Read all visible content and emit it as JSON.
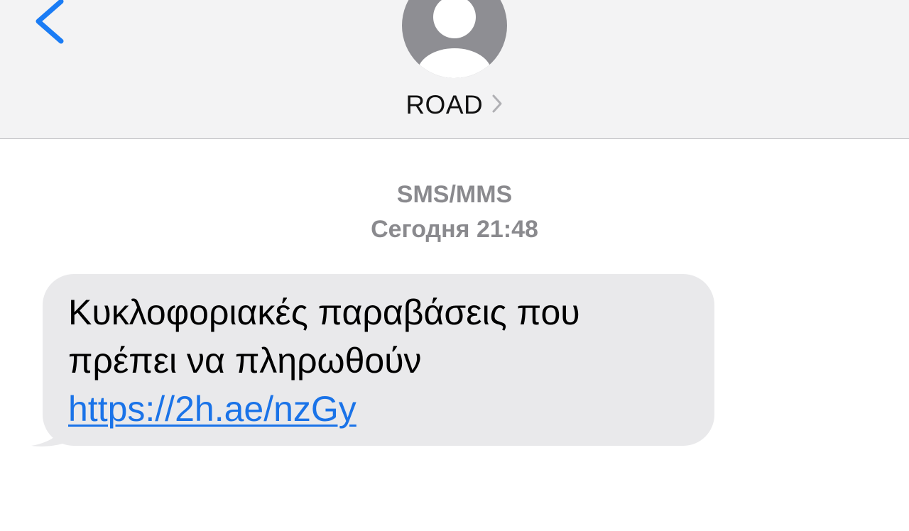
{
  "header": {
    "back_icon": "chevron-left-icon",
    "avatar_icon": "person-silhouette-icon",
    "contact_name": "ROAD",
    "contact_chevron_icon": "chevron-right-icon",
    "background_color": "#f3f3f4",
    "accent_color": "#1a7cf5"
  },
  "conversation": {
    "service_label": "SMS/MMS",
    "timestamp": "Сегодня 21:48",
    "messages": [
      {
        "direction": "incoming",
        "text": "Κυκλοφοριακές παραβάσεις που πρέπει να πληρωθούν",
        "link": "https://2h.ae/nzGy",
        "bubble_color": "#e9e9eb",
        "link_color": "#1a73e8"
      }
    ]
  }
}
